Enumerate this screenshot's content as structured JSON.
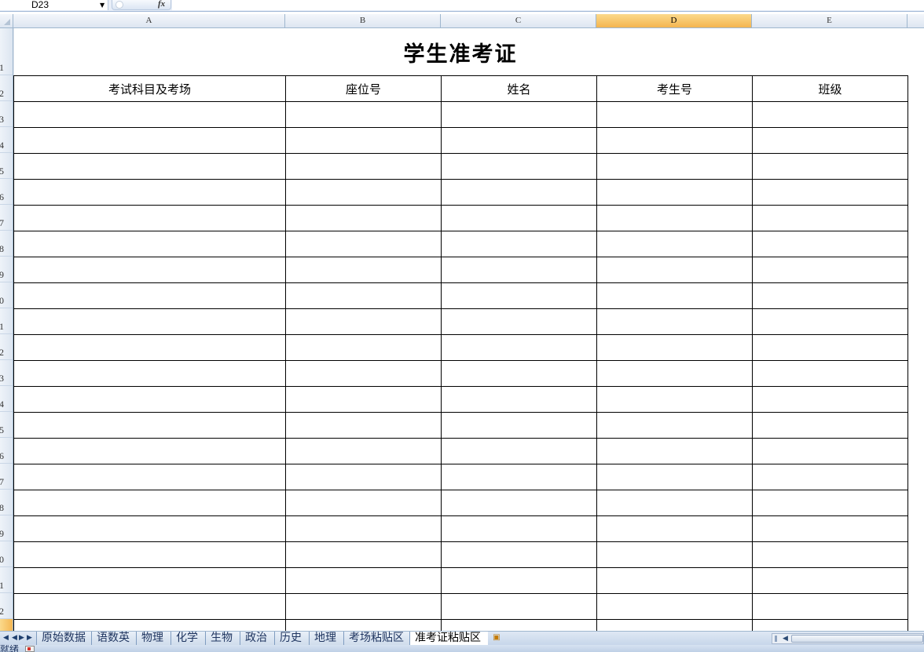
{
  "formula_bar": {
    "name_box": "D23",
    "fx_label": "fx"
  },
  "columns": [
    {
      "letter": "A",
      "width": 346
    },
    {
      "letter": "B",
      "width": 198
    },
    {
      "letter": "C",
      "width": 198
    },
    {
      "letter": "D",
      "width": 198,
      "active": true
    },
    {
      "letter": "E",
      "width": 198
    }
  ],
  "rows": [
    {
      "label": "1",
      "height": 60
    },
    {
      "label": "2",
      "height": 33
    },
    {
      "label": "3",
      "height": 33
    },
    {
      "label": "4",
      "height": 33
    },
    {
      "label": "5",
      "height": 33
    },
    {
      "label": "6",
      "height": 33
    },
    {
      "label": "7",
      "height": 33
    },
    {
      "label": "8",
      "height": 33
    },
    {
      "label": "9",
      "height": 33
    },
    {
      "label": "0",
      "height": 33
    },
    {
      "label": "1",
      "height": 33
    },
    {
      "label": "2",
      "height": 33
    },
    {
      "label": "3",
      "height": 33
    },
    {
      "label": "4",
      "height": 33
    },
    {
      "label": "5",
      "height": 33
    },
    {
      "label": "6",
      "height": 33
    },
    {
      "label": "7",
      "height": 33
    },
    {
      "label": "8",
      "height": 33
    },
    {
      "label": "9",
      "height": 33
    },
    {
      "label": "0",
      "height": 33
    },
    {
      "label": "1",
      "height": 33
    },
    {
      "label": "2",
      "height": 33
    },
    {
      "label": "",
      "height": 33,
      "active": true
    }
  ],
  "sheet": {
    "title": "学生准考证",
    "headers": [
      "考试科目及考场",
      "座位号",
      "姓名",
      "考生号",
      "班级"
    ],
    "empty_rows": 21,
    "selected_cell": "D23"
  },
  "sheet_tabs": [
    {
      "label": "原始数据"
    },
    {
      "label": "语数英"
    },
    {
      "label": "物理"
    },
    {
      "label": "化学"
    },
    {
      "label": "生物"
    },
    {
      "label": "政治"
    },
    {
      "label": "历史"
    },
    {
      "label": "地理"
    },
    {
      "label": "考场粘贴区"
    },
    {
      "label": "准考证粘贴区",
      "active": true
    }
  ],
  "status_bar": {
    "text": "就绪"
  },
  "colors": {
    "header_bg": "#dde6f1",
    "active_header": "#f4b54f",
    "grid_border": "#000000",
    "tab_text": "#1f3560"
  }
}
